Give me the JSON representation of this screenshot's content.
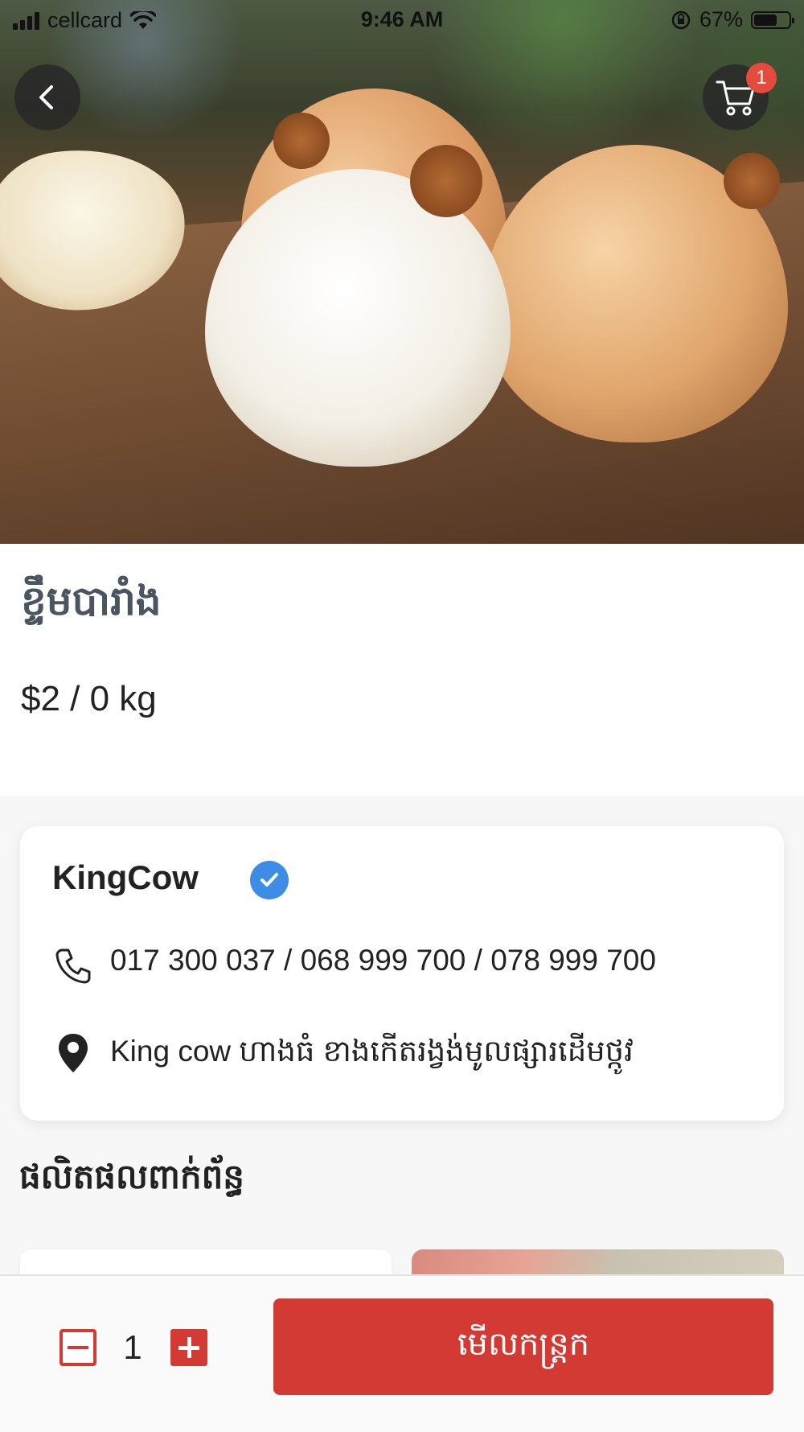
{
  "status_bar": {
    "carrier": "cellcard",
    "time": "9:46 AM",
    "battery_percent": "67%",
    "battery_level": 0.67
  },
  "hero": {
    "cart_badge_count": "1",
    "icons": [
      "chevron-left-icon",
      "cart-icon"
    ]
  },
  "product": {
    "title": "ខ្ទឹមបារាំង",
    "price": "$2 / 0 kg"
  },
  "shop": {
    "name": "KingCow",
    "verified_icon": "verified-check-icon",
    "phone": "017 300 037 / 068 999 700 / 078 999 700",
    "address": "King cow ហាងធំ ខាងកើតរង្វង់មូលផ្សារដើមថ្កូវ"
  },
  "recommended": {
    "title": "ផលិតផលពាក់ព័ន្ធ"
  },
  "bottom_bar": {
    "quantity": "1",
    "view_cart_label": "មើលកន្ត្រក"
  },
  "colors": {
    "accent_red": "#d33a33",
    "badge_red": "#e54b3c",
    "verified_blue": "#3d8de6",
    "title_gray": "#4a5560"
  }
}
